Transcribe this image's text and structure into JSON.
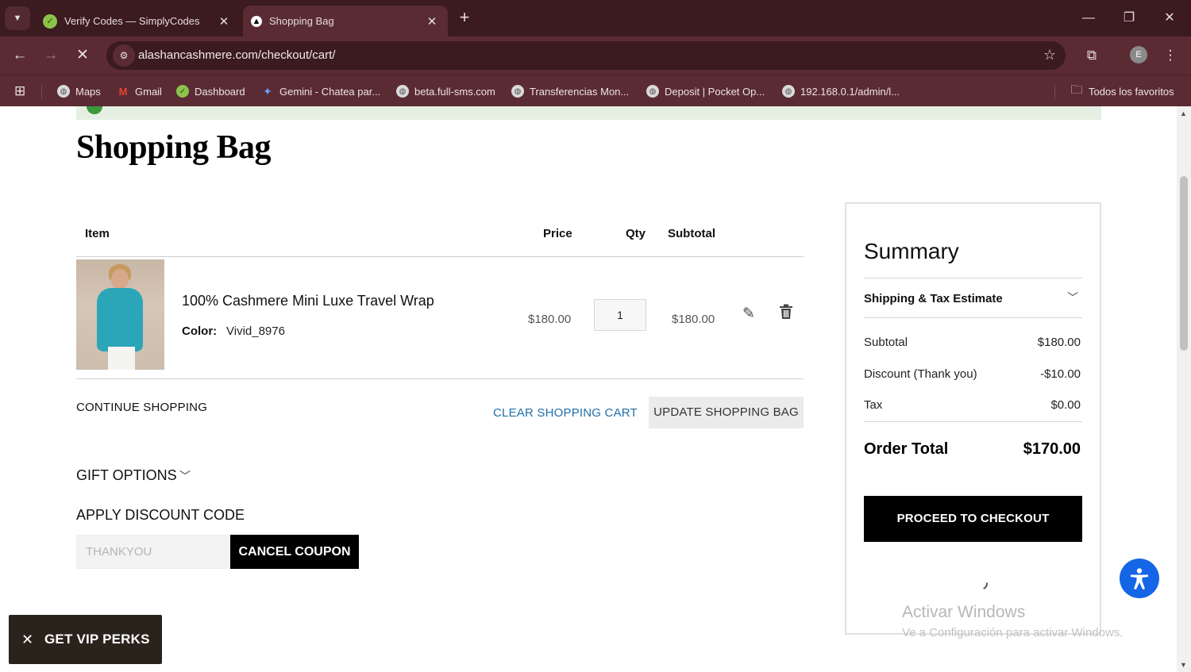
{
  "browser": {
    "tabs": [
      {
        "title": "Verify Codes — SimplyCodes",
        "active": false
      },
      {
        "title": "Shopping Bag",
        "active": true
      }
    ],
    "new_tab_label": "+",
    "url": "alashancashmere.com/checkout/cart/",
    "profile_initial": "E",
    "bookmarks": [
      {
        "label": "Maps"
      },
      {
        "label": "Gmail"
      },
      {
        "label": "Dashboard"
      },
      {
        "label": "Gemini - Chatea par..."
      },
      {
        "label": "beta.full-sms.com"
      },
      {
        "label": "Transferencias Mon..."
      },
      {
        "label": "Deposit | Pocket Op..."
      },
      {
        "label": "192.168.0.1/admin/l..."
      }
    ],
    "all_bookmarks_label": "Todos los favoritos"
  },
  "page": {
    "title": "Shopping Bag",
    "table": {
      "headers": {
        "item": "Item",
        "price": "Price",
        "qty": "Qty",
        "subtotal": "Subtotal"
      },
      "items": [
        {
          "name": "100% Cashmere Mini Luxe Travel Wrap",
          "color_label": "Color:",
          "color_value": "Vivid_8976",
          "price": "$180.00",
          "qty": "1",
          "subtotal": "$180.00"
        }
      ]
    },
    "actions": {
      "continue": "CONTINUE SHOPPING",
      "clear": "CLEAR SHOPPING CART",
      "update": "UPDATE SHOPPING BAG"
    },
    "gift_options": "GIFT OPTIONS",
    "discount": {
      "title": "APPLY DISCOUNT CODE",
      "code_value": "THANKYOU",
      "cancel_label": "CANCEL COUPON"
    },
    "summary": {
      "title": "Summary",
      "shipping_tax": "Shipping & Tax Estimate",
      "rows": [
        {
          "label": "Subtotal",
          "value": "$180.00"
        },
        {
          "label": "Discount (Thank you)",
          "value": "-$10.00"
        },
        {
          "label": "Tax",
          "value": "$0.00"
        }
      ],
      "order_total_label": "Order Total",
      "order_total_value": "$170.00",
      "checkout_label": "PROCEED TO CHECKOUT"
    },
    "vip_label": "GET VIP PERKS"
  },
  "os_watermark": {
    "line1": "Activar Windows",
    "line2": "Ve a Configuración para activar Windows."
  },
  "colors": {
    "chrome_dark": "#3b1a20",
    "chrome_mid": "#5a2b33",
    "link_blue": "#1f6fa8",
    "accessibility_blue": "#1466e6",
    "banner_green": "#e5f0e2"
  }
}
